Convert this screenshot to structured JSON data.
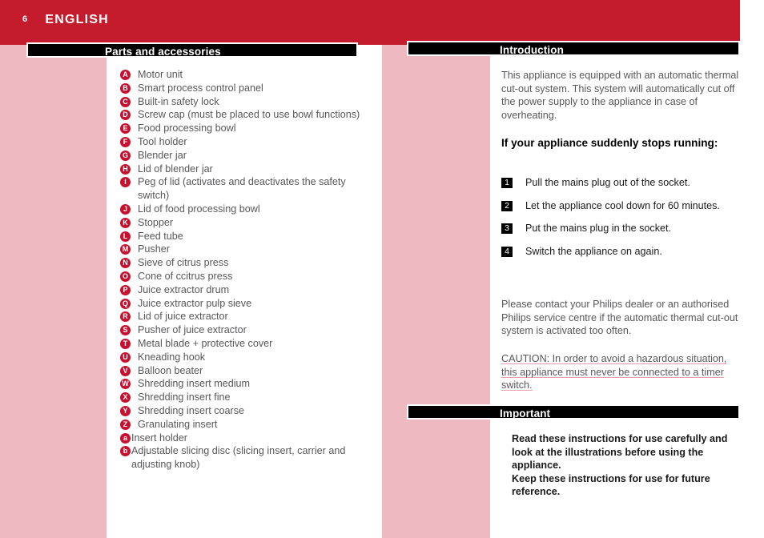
{
  "masthead": {
    "folio": "6",
    "language": "ENGLISH"
  },
  "left_page": {
    "section_title": "Parts and accessories",
    "parts": [
      {
        "key": "A",
        "label": "Motor unit"
      },
      {
        "key": "B",
        "label": "Smart process control panel"
      },
      {
        "key": "C",
        "label": "Built-in safety lock"
      },
      {
        "key": "D",
        "label": "Screw cap (must be placed to use bowl functions)"
      },
      {
        "key": "E",
        "label": "Food processing bowl"
      },
      {
        "key": "F",
        "label": "Tool holder"
      },
      {
        "key": "G",
        "label": "Blender jar"
      },
      {
        "key": "H",
        "label": "Lid of blender jar"
      },
      {
        "key": "I",
        "label": "Peg of lid (activates and deactivates the safety switch)"
      },
      {
        "key": "J",
        "label": "Lid of food processing bowl"
      },
      {
        "key": "K",
        "label": "Stopper"
      },
      {
        "key": "L",
        "label": "Feed tube"
      },
      {
        "key": "M",
        "label": "Pusher"
      },
      {
        "key": "N",
        "label": "Sieve of citrus press"
      },
      {
        "key": "O",
        "label": "Cone of ccitrus press"
      },
      {
        "key": "P",
        "label": "Juice extractor drum"
      },
      {
        "key": "Q",
        "label": "Juice extractor pulp sieve"
      },
      {
        "key": "R",
        "label": "Lid of juice extractor"
      },
      {
        "key": "S",
        "label": "Pusher of juice extractor"
      },
      {
        "key": "T",
        "label": "Metal blade + protective cover"
      },
      {
        "key": "U",
        "label": "Kneading hook"
      },
      {
        "key": "V",
        "label": "Balloon beater"
      },
      {
        "key": "W",
        "label": "Shredding insert medium"
      },
      {
        "key": "X",
        "label": "Shredding insert fine"
      },
      {
        "key": "Y",
        "label": "Shredding insert coarse"
      },
      {
        "key": "Z",
        "label": "Granulating insert"
      },
      {
        "key": "a",
        "label": "Insert holder"
      },
      {
        "key": "b",
        "label": "Adjustable slicing disc (slicing insert, carrier and adjusting knob)"
      }
    ]
  },
  "right_page": {
    "introduction": {
      "section_title": "Introduction",
      "paragraph": "This appliance is equipped with an automatic thermal cut-out system. This system will automatically cut off the power supply to the appliance in case of overheating.",
      "subhead": "If your appliance suddenly stops running:",
      "steps": [
        {
          "num": "1",
          "text": "Pull the mains plug out of the socket."
        },
        {
          "num": "2",
          "text": "Let the appliance cool down for 60 minutes."
        },
        {
          "num": "3",
          "text": "Put the mains plug in the socket."
        },
        {
          "num": "4",
          "text": "Switch the appliance on again."
        }
      ],
      "contact_paragraph": "Please contact your Philips dealer or an authorised Philips service centre if the automatic thermal cut-out system is activated too often.",
      "caution_paragraph": "CAUTION: In order to avoid a hazardous situation, this appliance must never be connected to a timer switch."
    },
    "important": {
      "section_title": "Important",
      "lines": [
        "Read these instructions for use carefully and look at the illustrations before using the appliance.",
        "Keep these instructions for use for future reference."
      ]
    }
  },
  "colors": {
    "masthead_red": "#c41c2d",
    "margin_pink": "#eeb9c0",
    "badge_red": "#c8102e",
    "bar_black": "#000000",
    "body_gray": "#58585a",
    "caution_underline": "#e2a0ab"
  }
}
